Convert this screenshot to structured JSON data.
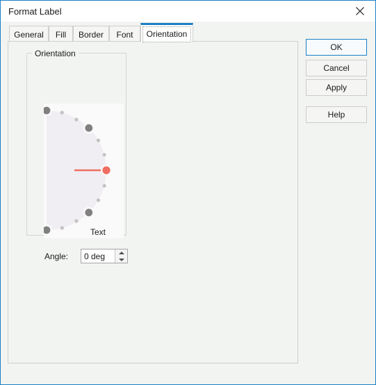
{
  "window": {
    "title": "Format Label",
    "close_icon": "close-icon"
  },
  "tabs": [
    {
      "label": "General",
      "active": false
    },
    {
      "label": "Fill",
      "active": false
    },
    {
      "label": "Border",
      "active": false
    },
    {
      "label": "Font",
      "active": false
    },
    {
      "label": "Orientation",
      "active": true
    }
  ],
  "orientation_panel": {
    "group_legend": "Orientation",
    "dial": {
      "text_label": "Text",
      "handle_angle_deg": 0,
      "disc_color": "#f0eef2",
      "handle_color": "#ee6d60",
      "pointer_line_color": "#ee6d60",
      "major_dot_color": "#808080",
      "minor_dot_color": "#c3c3c3",
      "canvas_color": "#fafafa",
      "major_tick_angles": [
        90,
        45,
        0,
        -45,
        -90
      ],
      "minor_tick_angles": [
        75,
        60,
        30,
        15,
        -15,
        -30,
        -60,
        -75
      ]
    },
    "angle_field": {
      "label": "Angle:",
      "value": "0 deg",
      "spin_up_icon": "chevron-up-icon",
      "spin_down_icon": "chevron-down-icon"
    }
  },
  "buttons": {
    "ok": "OK",
    "cancel": "Cancel",
    "apply": "Apply",
    "help": "Help"
  },
  "colors": {
    "accent": "#1a7fc4",
    "dialog_bg": "#f2f4f1",
    "titlebar_bg": "#ffffff"
  }
}
